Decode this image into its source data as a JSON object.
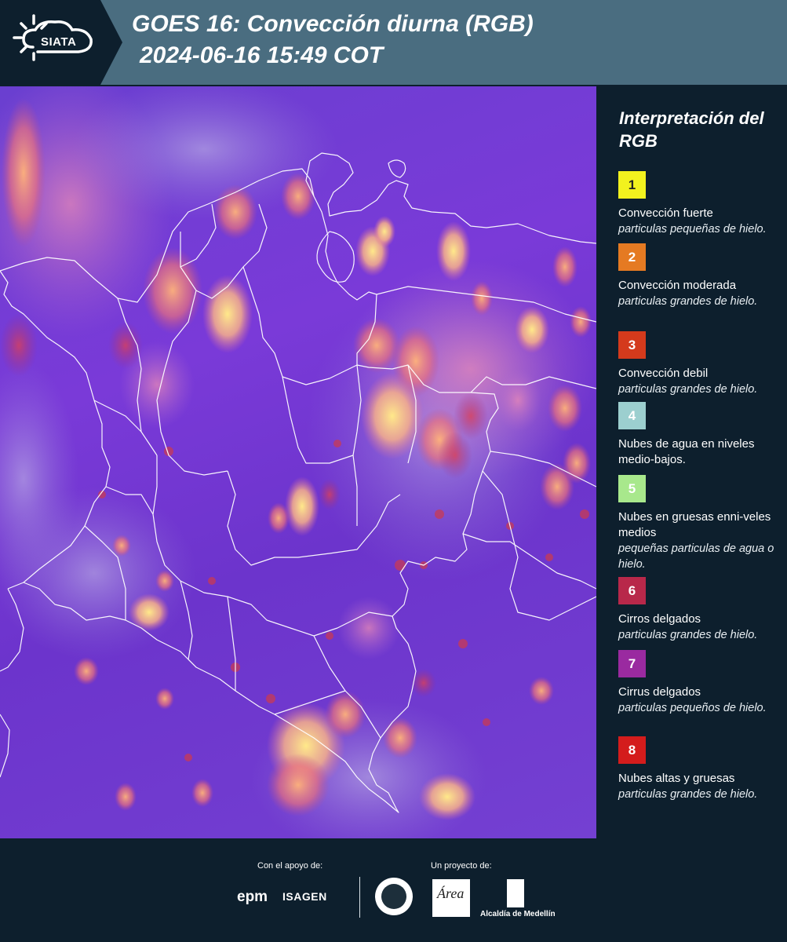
{
  "header": {
    "logo_text": "SIATA",
    "title_line1": "GOES 16: Convección diurna (RGB)",
    "title_line2": "2024-06-16 15:49 COT"
  },
  "legend": {
    "title": "Interpretación del RGB",
    "items": [
      {
        "number": "1",
        "color": "#f2f21e",
        "label": "Convección fuerte",
        "desc": "particulas pequeñas de hielo."
      },
      {
        "number": "2",
        "color": "#e57a22",
        "label": "Convección moderada",
        "desc": "particulas grandes de hielo."
      },
      {
        "number": "3",
        "color": "#d43a1c",
        "label": "Convección debil",
        "desc": "particulas grandes de hielo."
      },
      {
        "number": "4",
        "color": "#9ccfcf",
        "label": "Nubes de agua en niveles medio-bajos.",
        "desc": ""
      },
      {
        "number": "5",
        "color": "#a8e88c",
        "label": "Nubes en gruesas enni-veles medios",
        "desc": "pequeñas particulas de agua o hielo."
      },
      {
        "number": "6",
        "color": "#b8284a",
        "label": "Cirros delgados",
        "desc": "particulas grandes de hielo."
      },
      {
        "number": "7",
        "color": "#9a2aa0",
        "label": "Cirrus delgados",
        "desc": "particulas pequeños de hielo."
      },
      {
        "number": "8",
        "color": "#d41c1c",
        "label": "Nubes altas y gruesas",
        "desc": "particulas grandes de hielo."
      }
    ]
  },
  "footer": {
    "support_label": "Con el apoyo de:",
    "project_label": "Un proyecto de:",
    "sponsor1": "epm",
    "sponsor2": "ISAGEN",
    "partner_area": "Área",
    "partner_alcaldia": "Alcaldía de Medellín"
  }
}
